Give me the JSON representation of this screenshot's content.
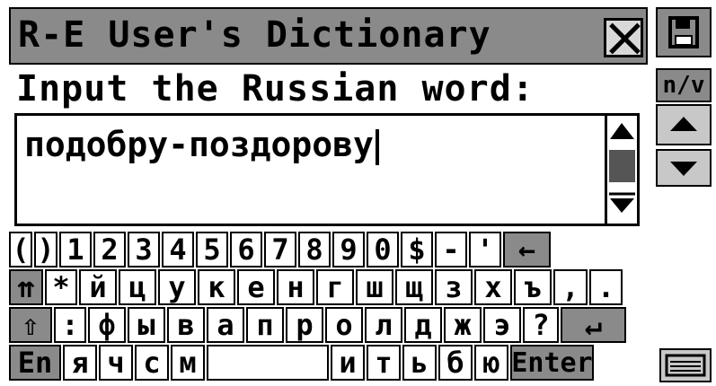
{
  "window": {
    "title": "R-E User's Dictionary"
  },
  "prompt": "Input the Russian word:",
  "input": {
    "value": "подобру-поздорову"
  },
  "side": {
    "nv_label": "n/v"
  },
  "keyboard": {
    "row1": [
      "(",
      ")",
      "1",
      "2",
      "3",
      "4",
      "5",
      "6",
      "7",
      "8",
      "9",
      "0",
      "$",
      "-",
      "'",
      "←"
    ],
    "row2": [
      "⇈",
      "*",
      "й",
      "ц",
      "у",
      "к",
      "е",
      "н",
      "г",
      "ш",
      "щ",
      "з",
      "х",
      "ъ",
      ",",
      "."
    ],
    "row3": [
      "⇧",
      ":",
      "ф",
      "ы",
      "в",
      "а",
      "п",
      "р",
      "о",
      "л",
      "д",
      "ж",
      "э",
      "?",
      "↵"
    ],
    "row4": [
      "En",
      "я",
      "ч",
      "с",
      "м",
      "",
      "и",
      "т",
      "ь",
      "б",
      "ю",
      "Enter"
    ]
  },
  "icons": {
    "save": "floppy-icon",
    "close": "close-icon",
    "up": "arrow-up-icon",
    "down": "arrow-down-icon",
    "keyboard": "keyboard-icon"
  }
}
